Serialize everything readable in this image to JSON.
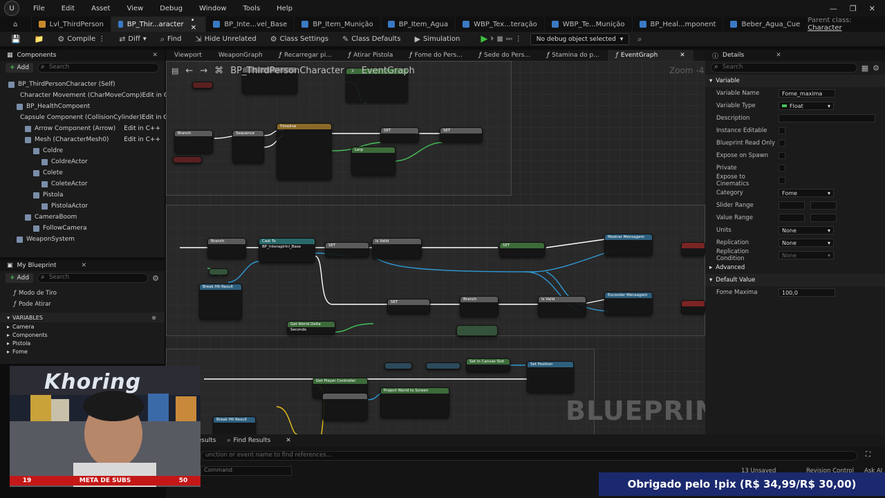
{
  "menubar": {
    "items": [
      "File",
      "Edit",
      "Asset",
      "View",
      "Debug",
      "Window",
      "Tools",
      "Help"
    ]
  },
  "tabs": [
    {
      "label": "Lvl_ThirdPerson",
      "kind": "level"
    },
    {
      "label": "BP_Thir...aracter",
      "kind": "bp",
      "active": true
    },
    {
      "label": "BP_Inte...vel_Base",
      "kind": "bp"
    },
    {
      "label": "BP_Item_Munição",
      "kind": "bp"
    },
    {
      "label": "BP_Item_Agua",
      "kind": "bp"
    },
    {
      "label": "WBP_Tex...teração",
      "kind": "bp"
    },
    {
      "label": "WBP_Te...Munição",
      "kind": "bp"
    },
    {
      "label": "BP_Heal...mponent",
      "kind": "bp"
    },
    {
      "label": "Beber_Agua_Cue",
      "kind": "bp"
    }
  ],
  "parent_class": {
    "label": "Parent class:",
    "value": "Character"
  },
  "toolbar": {
    "compile": "Compile",
    "diff": "Diff",
    "find": "Find",
    "hide_unrelated": "Hide Unrelated",
    "class_settings": "Class Settings",
    "class_defaults": "Class Defaults",
    "simulation": "Simulation",
    "debug_object": "No debug object selected"
  },
  "components": {
    "title": "Components",
    "add": "Add",
    "search_placeholder": "Search",
    "items": [
      {
        "label": "BP_ThirdPersonCharacter (Self)",
        "indent": 0,
        "edit": ""
      },
      {
        "label": "Character Movement (CharMoveComp)",
        "indent": 1,
        "edit": "Edit in C++"
      },
      {
        "label": "BP_HealthCompoent",
        "indent": 1,
        "edit": ""
      },
      {
        "label": "Capsule Component (CollisionCylinder)",
        "indent": 1,
        "edit": "Edit in C++"
      },
      {
        "label": "Arrow Component (Arrow)",
        "indent": 2,
        "edit": "Edit in C++"
      },
      {
        "label": "Mesh (CharacterMesh0)",
        "indent": 2,
        "edit": "Edit in C++"
      },
      {
        "label": "Coldre",
        "indent": 3,
        "edit": ""
      },
      {
        "label": "ColdreActor",
        "indent": 4,
        "edit": ""
      },
      {
        "label": "Colete",
        "indent": 3,
        "edit": ""
      },
      {
        "label": "ColeteActor",
        "indent": 4,
        "edit": ""
      },
      {
        "label": "Pistola",
        "indent": 3,
        "edit": ""
      },
      {
        "label": "PistolaActor",
        "indent": 4,
        "edit": ""
      },
      {
        "label": "CameraBoom",
        "indent": 2,
        "edit": ""
      },
      {
        "label": "FollowCamera",
        "indent": 3,
        "edit": ""
      },
      {
        "label": "WeaponSystem",
        "indent": 1,
        "edit": ""
      }
    ]
  },
  "my_blueprint": {
    "title": "My Blueprint",
    "add": "Add",
    "search_placeholder": "Search",
    "funcs": [
      "Modo de Tiro",
      "Pode Atirar"
    ],
    "variables_header": "VARIABLES",
    "categories": [
      "Camera",
      "Components",
      "Pistola",
      "Fome"
    ]
  },
  "graph_tabs": [
    "Viewport",
    "WeaponGraph",
    "Recarregar pi...",
    "Atirar Pistola",
    "Fome do Pers...",
    "Sede do Pers...",
    "Stamina do p...",
    "EventGraph"
  ],
  "graph": {
    "crumb_bp": "BP_ThirdPersonCharacter",
    "crumb_graph": "EventGraph",
    "zoom": "Zoom -4",
    "watermark": "BLUEPRINT",
    "nodes_a": [
      "Branch",
      "Sequence",
      "Timeline",
      "SET",
      "SET",
      "Lerp"
    ],
    "nodes_b": [
      "Branch",
      "Cast To BP_InteragirInl_Base",
      "SET",
      "Is Valid",
      "SET",
      "Mostrar Mensagem",
      "Break Hit Result",
      "SET",
      "Branch",
      "Is Valid",
      "Esconder Mensagem",
      "Get World Delta Seconds"
    ],
    "nodes_c": [
      "Get Player Controller",
      "Set in Canvas Slot",
      "Set Position",
      "Project World to Screen",
      "Break Hit Result"
    ]
  },
  "details": {
    "title": "Details",
    "search_placeholder": "Search",
    "section_variable": "Variable",
    "rows": [
      {
        "label": "Variable Name",
        "value": "Fome_maxima",
        "kind": "text"
      },
      {
        "label": "Variable Type",
        "value": "Float",
        "kind": "type"
      },
      {
        "label": "Description",
        "value": "",
        "kind": "text-wide"
      },
      {
        "label": "Instance Editable",
        "kind": "check"
      },
      {
        "label": "Blueprint Read Only",
        "kind": "check"
      },
      {
        "label": "Expose on Spawn",
        "kind": "check"
      },
      {
        "label": "Private",
        "kind": "check"
      },
      {
        "label": "Expose to Cinematics",
        "kind": "check"
      },
      {
        "label": "Category",
        "value": "Fome",
        "kind": "select"
      },
      {
        "label": "Slider Range",
        "kind": "range"
      },
      {
        "label": "Value Range",
        "kind": "range"
      },
      {
        "label": "Units",
        "value": "None",
        "kind": "select"
      },
      {
        "label": "Replication",
        "value": "None",
        "kind": "select"
      },
      {
        "label": "Replication Condition",
        "value": "None",
        "kind": "select"
      }
    ],
    "section_advanced": "Advanced",
    "section_default": "Default Value",
    "default_label": "Fome Maxima",
    "default_value": "100,0"
  },
  "bottom": {
    "tab_results": "Results",
    "tab_find": "Find Results",
    "find_placeholder": "unction or event name to find references...",
    "cmd_placeholder": "Command",
    "unsaved": "13 Unsaved",
    "revision": "Revision Control",
    "ask": "Ask AI"
  },
  "overlay": {
    "sub_banner": "Obrigado pelo !pix (R$ 34,99/R$ 30,00)",
    "meta_label": "META DE SUBS",
    "meta_current": "19",
    "meta_goal": "50",
    "meta_progress": 0.38,
    "cam_name": "Khoring"
  },
  "colors": {
    "accent": "#3a79c4",
    "green": "#46c25a",
    "banner": "#1b2a6e",
    "meta": "#c41818"
  }
}
